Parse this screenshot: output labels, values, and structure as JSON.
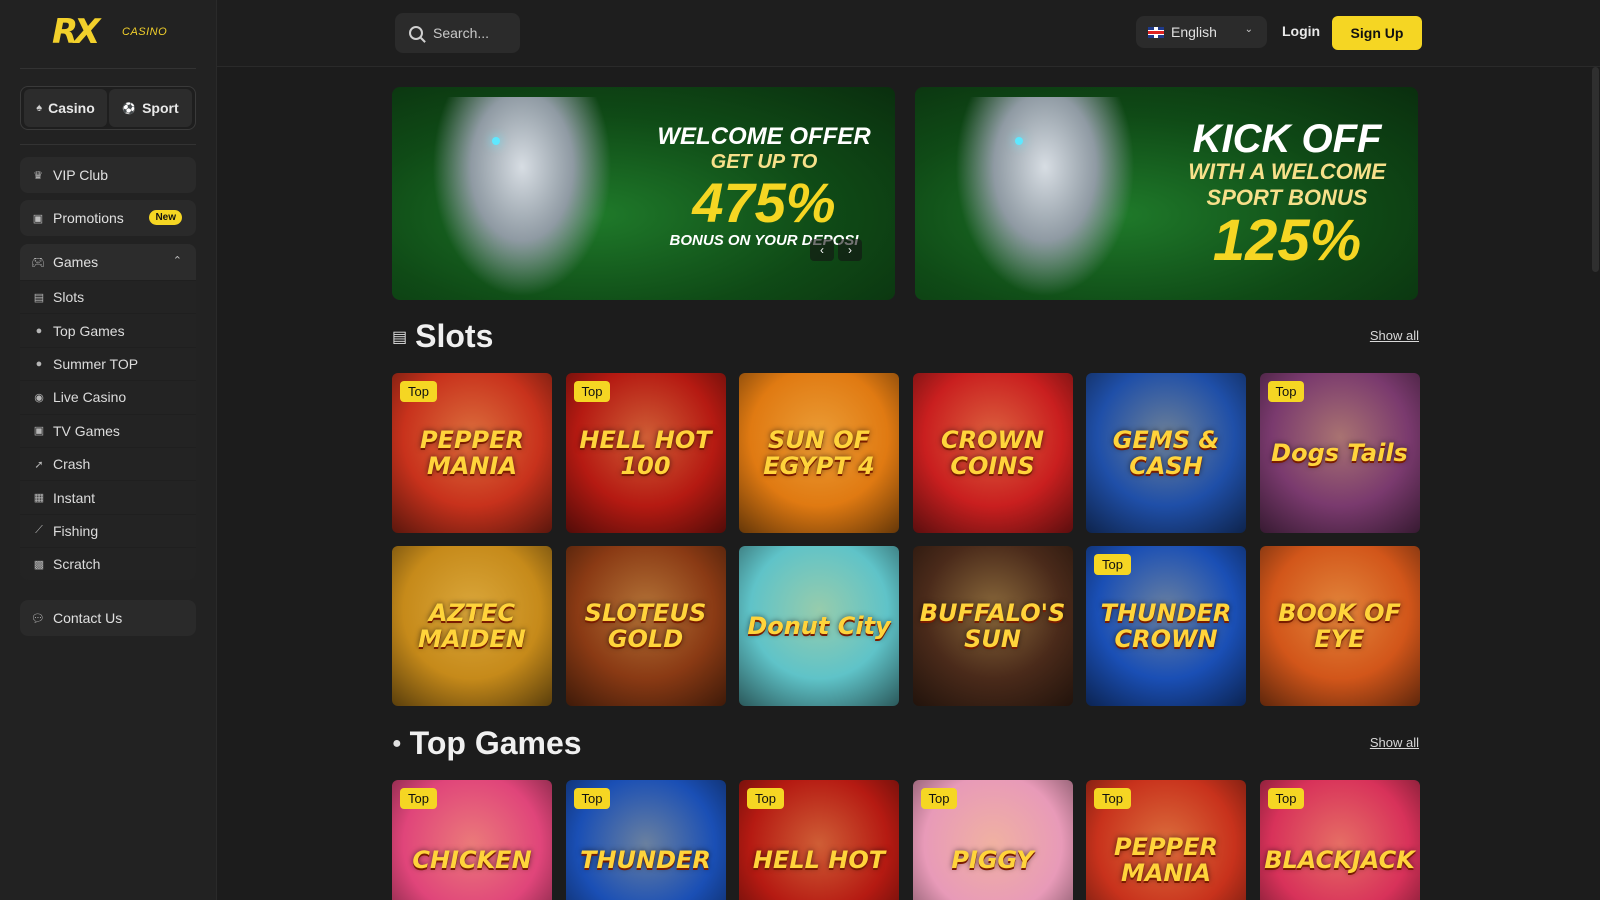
{
  "brand": {
    "logo_text": "RX",
    "logo_sub": "CASINO"
  },
  "sidebar": {
    "modes": [
      {
        "label": "Casino",
        "icon": "spade-icon"
      },
      {
        "label": "Sport",
        "icon": "ball-icon"
      }
    ],
    "vip_club": "VIP Club",
    "promotions": "Promotions",
    "promotions_badge": "New",
    "games_label": "Games",
    "games_items": [
      {
        "label": "Slots",
        "icon": "slots-icon"
      },
      {
        "label": "Top Games",
        "icon": "crown-icon"
      },
      {
        "label": "Summer TOP",
        "icon": "sun-icon"
      },
      {
        "label": "Live Casino",
        "icon": "chip-icon"
      },
      {
        "label": "TV Games",
        "icon": "tv-icon"
      },
      {
        "label": "Crash",
        "icon": "rocket-icon"
      },
      {
        "label": "Instant",
        "icon": "grid-icon"
      },
      {
        "label": "Fishing",
        "icon": "fishing-icon"
      },
      {
        "label": "Scratch",
        "icon": "ticket-icon"
      }
    ],
    "contact_us": "Contact Us"
  },
  "header": {
    "search_placeholder": "Search...",
    "language": "English",
    "login": "Login",
    "signup": "Sign Up"
  },
  "banners": [
    {
      "line1": "WELCOME OFFER",
      "line2": "GET UP TO",
      "line3": "475%",
      "line4": "BONUS ON YOUR DEPOSI"
    },
    {
      "line1": "KICK OFF",
      "line2": "WITH A WELCOME SPORT BONUS",
      "line3": "125%"
    }
  ],
  "slots": {
    "title": "Slots",
    "show_all": "Show all",
    "games": [
      {
        "name": "PEPPER MANIA",
        "top": true,
        "bg": "#c8321c"
      },
      {
        "name": "HELL HOT 100",
        "top": true,
        "bg": "#b51a12"
      },
      {
        "name": "SUN OF EGYPT 4",
        "top": false,
        "bg": "#e07a12"
      },
      {
        "name": "CROWN COINS",
        "top": false,
        "bg": "#c91f1f"
      },
      {
        "name": "GEMS & CASH",
        "top": false,
        "bg": "#1f4fa8"
      },
      {
        "name": "Dogs Tails",
        "top": true,
        "bg": "#7a3a6e"
      },
      {
        "name": "AZTEC MAIDEN",
        "top": false,
        "bg": "#c68a1a"
      },
      {
        "name": "SLOTEUS GOLD",
        "top": false,
        "bg": "#8a3a14"
      },
      {
        "name": "Donut City",
        "top": false,
        "bg": "#5fc3c8"
      },
      {
        "name": "BUFFALO'S SUN",
        "top": false,
        "bg": "#4a2a1a"
      },
      {
        "name": "THUNDER CROWN",
        "top": true,
        "bg": "#1a4fb5"
      },
      {
        "name": "BOOK OF EYE",
        "top": false,
        "bg": "#d2561a"
      }
    ]
  },
  "top_games": {
    "title": "Top Games",
    "show_all": "Show all",
    "games": [
      {
        "name": "CHICKEN",
        "top": true,
        "bg": "#e0457a"
      },
      {
        "name": "THUNDER",
        "top": true,
        "bg": "#1a4fb5"
      },
      {
        "name": "HELL HOT",
        "top": true,
        "bg": "#b51a12"
      },
      {
        "name": "PIGGY",
        "top": true,
        "bg": "#e89ab8"
      },
      {
        "name": "PEPPER MANIA",
        "top": true,
        "bg": "#c8321c"
      },
      {
        "name": "BLACKJACK",
        "top": true,
        "bg": "#d8325a"
      }
    ]
  },
  "top_badge_label": "Top",
  "colors": {
    "accent": "#f5d623",
    "bg": "#1c1c1c",
    "sidebar": "#222222"
  }
}
